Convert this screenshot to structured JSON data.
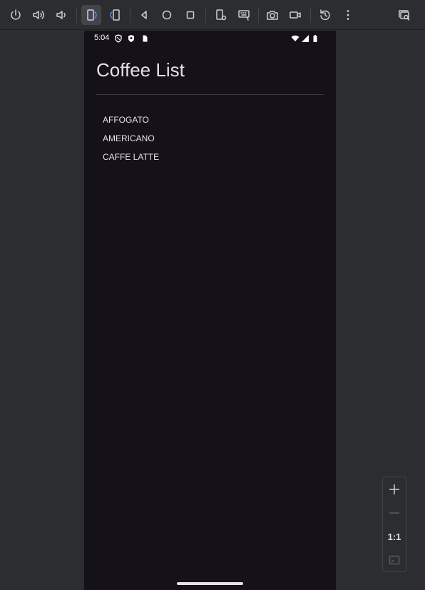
{
  "toolbar": {
    "buttons": [
      {
        "name": "power-icon"
      },
      {
        "name": "volume-up-icon"
      },
      {
        "name": "volume-down-icon"
      },
      {
        "name": "rotate-left-icon"
      },
      {
        "name": "rotate-right-icon"
      },
      {
        "name": "back-icon"
      },
      {
        "name": "home-icon"
      },
      {
        "name": "overview-icon"
      },
      {
        "name": "device-settings-icon"
      },
      {
        "name": "keyboard-icon"
      },
      {
        "name": "camera-icon"
      },
      {
        "name": "video-icon"
      },
      {
        "name": "snapshot-restore-icon"
      },
      {
        "name": "more-vertical-icon"
      },
      {
        "name": "zoom-window-icon"
      }
    ]
  },
  "status_bar": {
    "time": "5:04"
  },
  "app": {
    "title": "Coffee List",
    "items": [
      "AFFOGATO",
      "AMERICANO",
      "CAFFE LATTE"
    ]
  },
  "zoom": {
    "actual_size_label": "1:1"
  }
}
